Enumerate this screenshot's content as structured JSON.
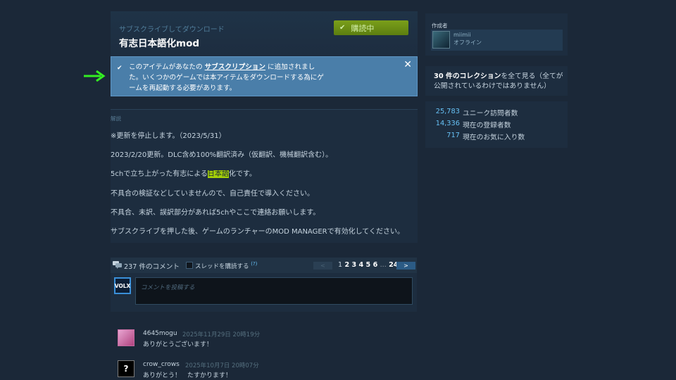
{
  "header": {
    "subtitle": "サブスクライブしてダウンロード",
    "title": "有志日本語化mod",
    "subscribe_label": "購読中"
  },
  "notice": {
    "pre": "このアイテムがあなたの",
    "link": "サブスクリプション",
    "post": "に追加されました。いくつかのゲームでは本アイテムをダウンロードする為にゲームを再起動する必要があります。"
  },
  "description": {
    "label": "解説",
    "lines": [
      "※更新を停止します。（2023/5/31）",
      "2023/2/20更新。DLC含め100%翻訳済み（仮翻訳、機械翻訳含む）。",
      "5chで立ち上がった有志による",
      "不具合の検証などしていませんので、自己責任で導入ください。",
      "不具合、未訳、誤訳部分があれば5chやここで連絡お願いします。",
      "サブスクライブを押した後、ゲームのランチャーのMOD MANAGERで有効化してください。"
    ],
    "highlight": "日本語",
    "line3_end": "化です。"
  },
  "author": {
    "label": "作成者",
    "name": "miimii",
    "status": "オフライン"
  },
  "collections": {
    "bold": "30 件のコレクション",
    "rest": "を全て見る（全てが公開されているわけではありません）"
  },
  "stats": [
    {
      "num": "25,783",
      "label": "ユニーク訪問者数"
    },
    {
      "num": "14,336",
      "label": "現在の登録者数"
    },
    {
      "num": "717",
      "label": "現在のお気に入り数"
    }
  ],
  "comments_bar": {
    "count": "237 件のコメント",
    "subscribe_thread": "スレッドを購読する",
    "help": "(?)",
    "prev": "<",
    "page_current": "1",
    "pages": [
      "2",
      "3",
      "4",
      "5",
      "6"
    ],
    "dots": "...",
    "last": "24",
    "next": ">"
  },
  "comment_form": {
    "avatar_text": "VOLX",
    "placeholder": "コメントを投稿する"
  },
  "comments": [
    {
      "name": "4645mogu",
      "date": "2025年11月29日 20時19分",
      "text": "ありがとうございます！"
    },
    {
      "name": "crow_crows",
      "date": "2025年10月7日 20時07分",
      "text": "ありがとう！　たすかります！",
      "avatar": "?"
    }
  ],
  "colors": {
    "background": "#1b2838",
    "notice": "#4a7ea9",
    "subscribe_green": "#6a8f15",
    "link_blue": "#67c1f5",
    "highlight": "#a4d007"
  }
}
